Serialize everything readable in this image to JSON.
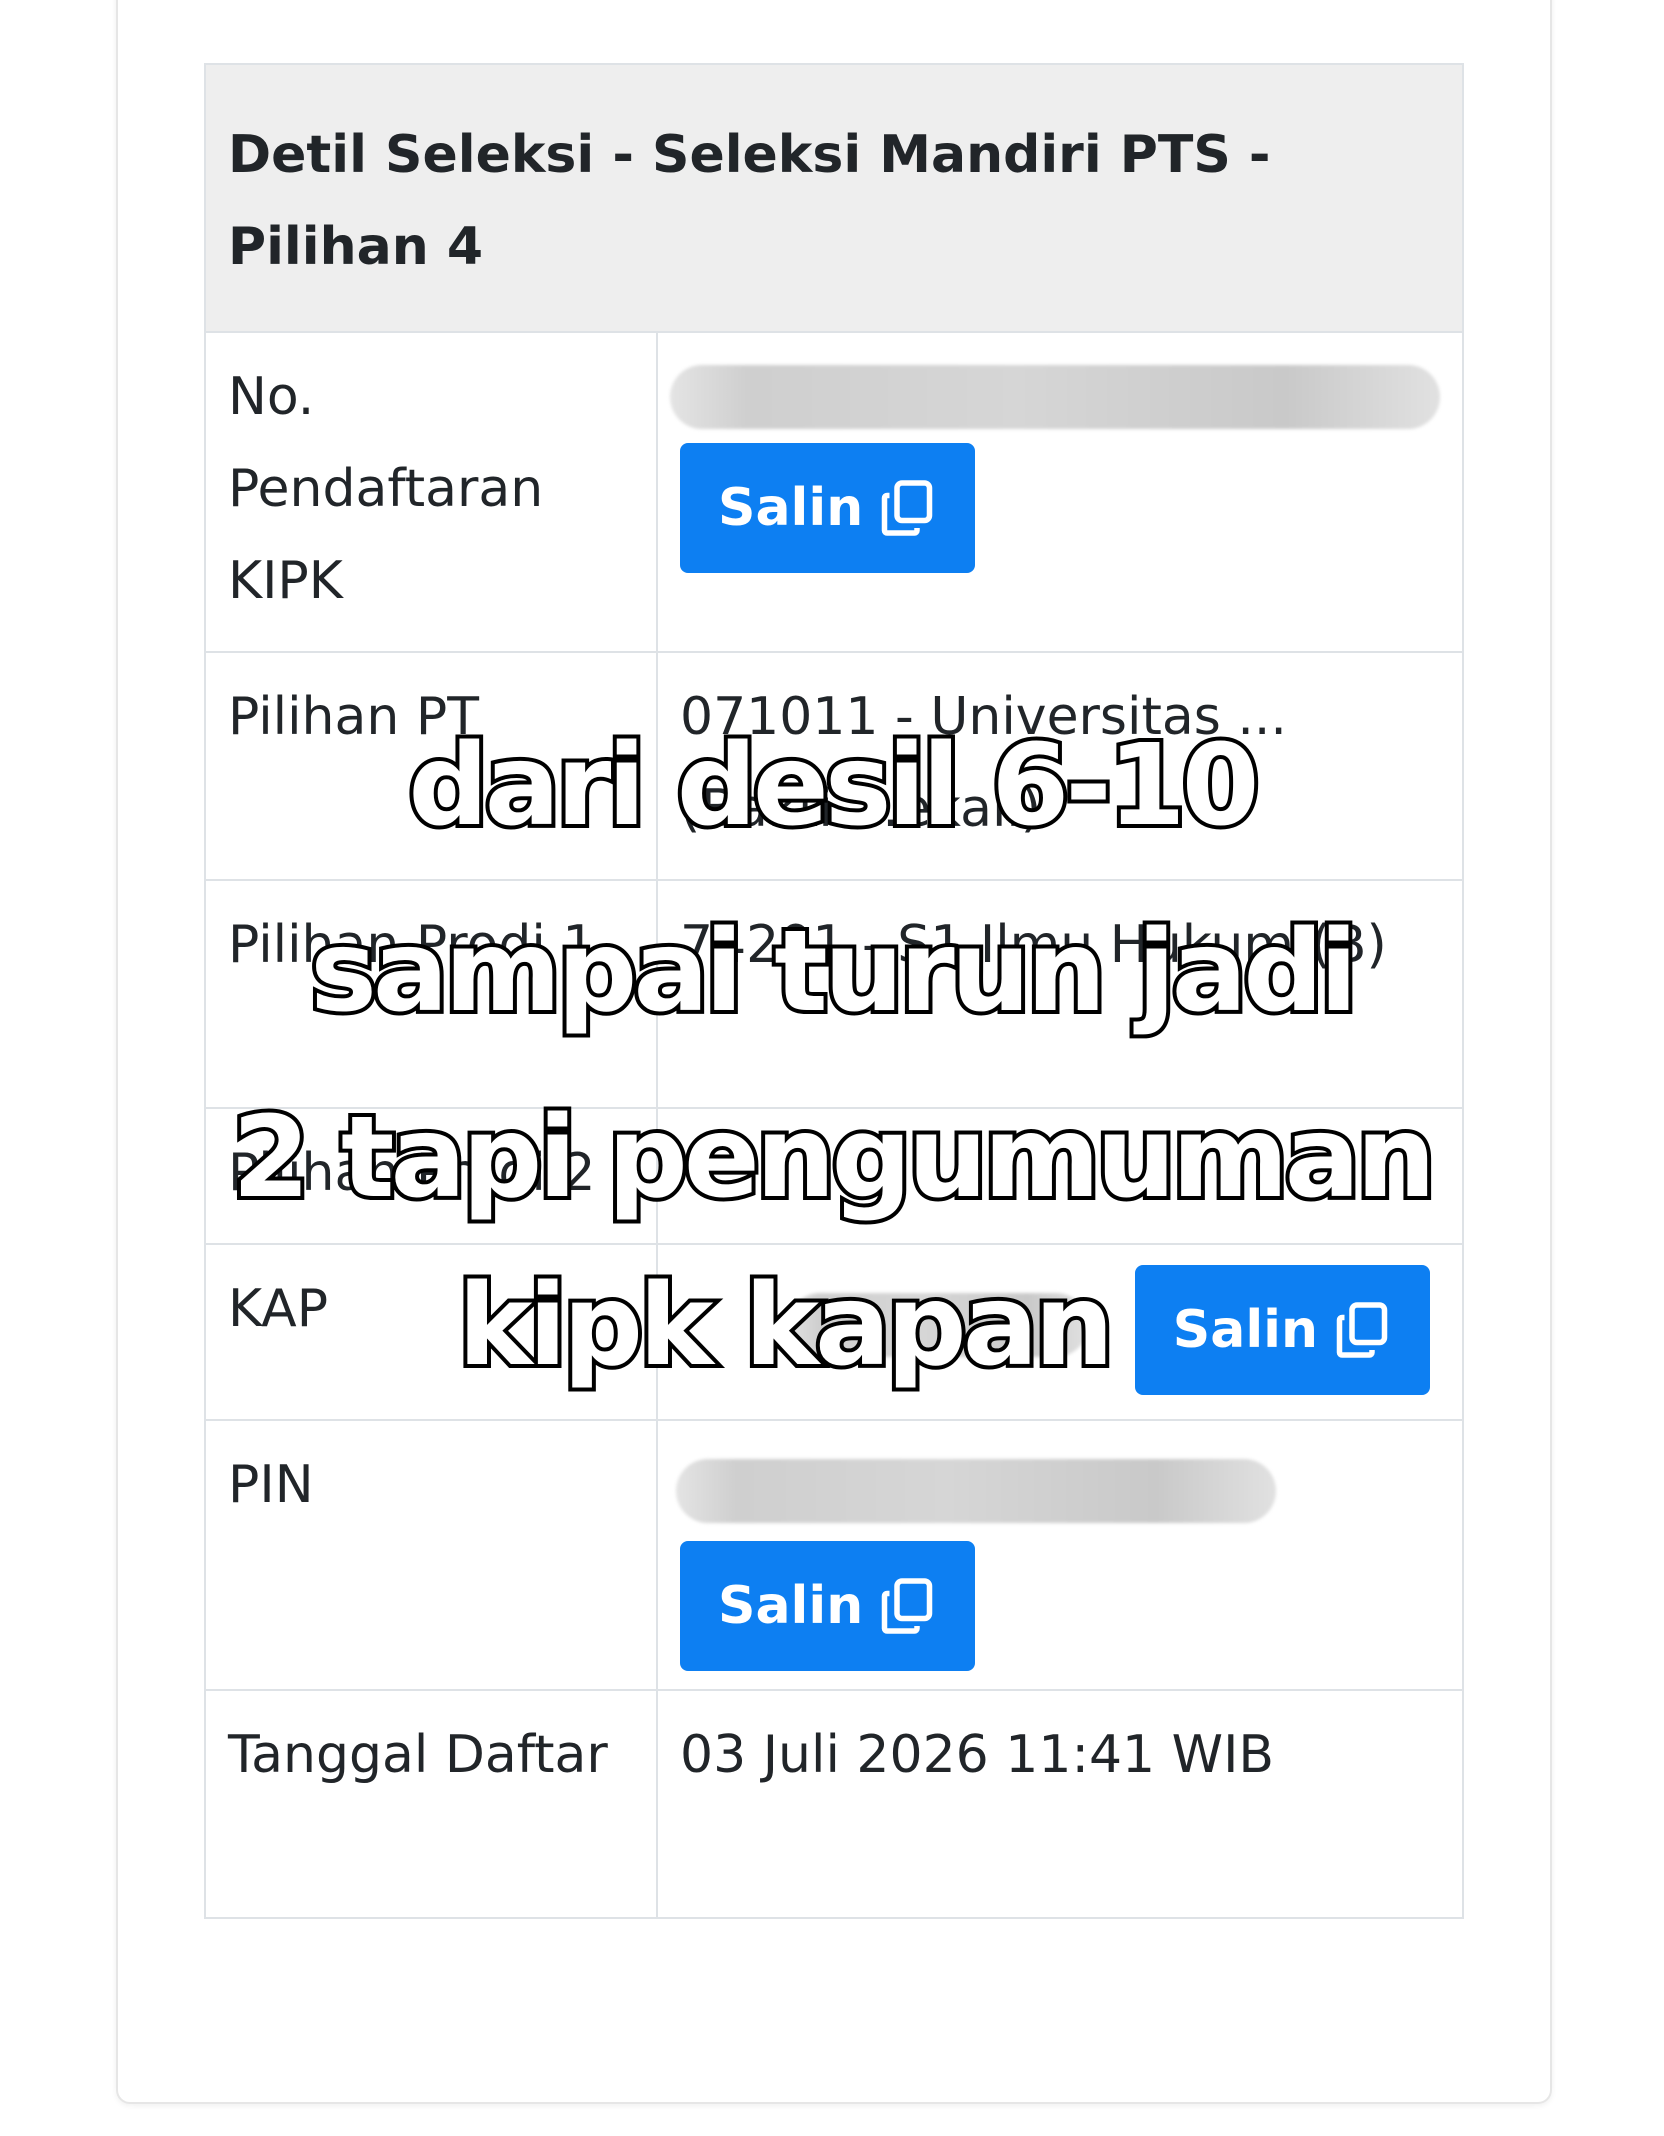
{
  "card": {
    "title": "Detil Seleksi - Seleksi Mandiri PTS - Pilihan 4"
  },
  "rows": {
    "kipk": {
      "label": "No. Pendaftaran KIPK",
      "button": "Salin"
    },
    "pt": {
      "label": "Pilihan PT",
      "value": "071011 - Universitas ... (Bakti ...ekali)"
    },
    "prodi1": {
      "label": "Pilihan Prodi 1",
      "value": "74201 - S1 Ilmu Hukum (B)"
    },
    "prodi2": {
      "label": "Pilihan Prodi 2",
      "value": ""
    },
    "kap": {
      "label": "KAP",
      "button": "Salin"
    },
    "pin": {
      "label": "PIN",
      "button": "Salin"
    },
    "tanggal": {
      "label": "Tanggal Daftar",
      "value": "03 Juli 2026 11:41 WIB"
    }
  },
  "caption": {
    "line1": "dari desil 6-10",
    "line2": "sampai turun jadi",
    "line3": "2 tapi pengumuman",
    "line4": "kipk kapan"
  },
  "colors": {
    "button": "#0d7ff2",
    "header_bg": "#eeeeee",
    "border": "#dee2e6",
    "text": "#212529"
  },
  "icons": {
    "copy": "copy-icon"
  }
}
